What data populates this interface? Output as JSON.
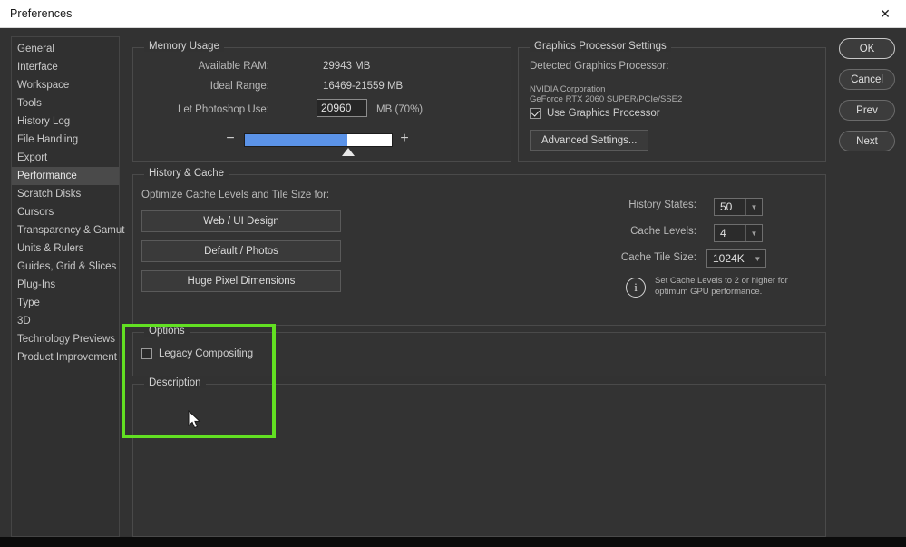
{
  "window": {
    "title": "Preferences",
    "close_icon": "close-x-icon"
  },
  "sidebar": {
    "items": [
      {
        "label": "General",
        "selected": false
      },
      {
        "label": "Interface",
        "selected": false
      },
      {
        "label": "Workspace",
        "selected": false
      },
      {
        "label": "Tools",
        "selected": false
      },
      {
        "label": "History Log",
        "selected": false
      },
      {
        "label": "File Handling",
        "selected": false
      },
      {
        "label": "Export",
        "selected": false
      },
      {
        "label": "Performance",
        "selected": true
      },
      {
        "label": "Scratch Disks",
        "selected": false
      },
      {
        "label": "Cursors",
        "selected": false
      },
      {
        "label": "Transparency & Gamut",
        "selected": false
      },
      {
        "label": "Units & Rulers",
        "selected": false
      },
      {
        "label": "Guides, Grid & Slices",
        "selected": false
      },
      {
        "label": "Plug-Ins",
        "selected": false
      },
      {
        "label": "Type",
        "selected": false
      },
      {
        "label": "3D",
        "selected": false
      },
      {
        "label": "Technology Previews",
        "selected": false
      },
      {
        "label": "Product Improvement",
        "selected": false
      }
    ]
  },
  "memory_usage": {
    "legend": "Memory Usage",
    "available_ram_label": "Available RAM:",
    "available_ram_value": "29943 MB",
    "ideal_range_label": "Ideal Range:",
    "ideal_range_value": "16469-21559 MB",
    "let_photoshop_use_label": "Let Photoshop Use:",
    "let_photoshop_use_value": "20960",
    "unit_percent": "MB (70%)",
    "slider_percent": 70,
    "minus_label": "−",
    "plus_label": "+",
    "fill_color": "#5b93e8"
  },
  "graphics": {
    "legend": "Graphics Processor Settings",
    "detected_label": "Detected Graphics Processor:",
    "vendor": "NVIDIA Corporation",
    "model": "GeForce RTX 2060 SUPER/PCIe/SSE2",
    "use_gpu_label": "Use Graphics Processor",
    "use_gpu_checked": true,
    "advanced_button": "Advanced Settings..."
  },
  "history_cache": {
    "legend": "History & Cache",
    "optimize_label": "Optimize Cache Levels and Tile Size for:",
    "presets": [
      "Web / UI Design",
      "Default / Photos",
      "Huge Pixel Dimensions"
    ],
    "history_states_label": "History States:",
    "history_states_value": "50",
    "cache_levels_label": "Cache Levels:",
    "cache_levels_value": "4",
    "cache_tile_size_label": "Cache Tile Size:",
    "cache_tile_size_value": "1024K",
    "arrow_glyph": "▼",
    "info_icon_glyph": "i",
    "info_text_line1": "Set Cache Levels to 2 or higher for",
    "info_text_line2": "optimum GPU performance."
  },
  "options": {
    "legend": "Options",
    "legacy_compositing_label": "Legacy Compositing",
    "legacy_compositing_checked": false
  },
  "description": {
    "legend": "Description"
  },
  "buttons": {
    "ok": "OK",
    "cancel": "Cancel",
    "prev": "Prev",
    "next": "Next"
  },
  "annotation": {
    "color": "#62e022"
  }
}
